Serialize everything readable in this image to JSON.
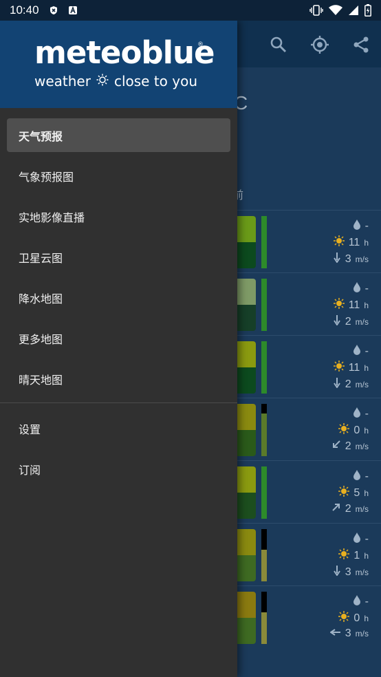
{
  "status_bar": {
    "time": "10:40",
    "left_icons": [
      "privacy-shield-icon",
      "text-a-icon"
    ],
    "right_icons": [
      "vibrate-icon",
      "wifi-icon",
      "signal-icon",
      "battery-icon"
    ]
  },
  "drawer": {
    "logo": "meteoblue",
    "logo_mark": "®",
    "tagline_left": "weather",
    "tagline_right": "close to you",
    "items": [
      {
        "label": "天气预报",
        "active": true
      },
      {
        "label": "气象预报图"
      },
      {
        "label": "实地影像直播"
      },
      {
        "label": "卫星云图"
      },
      {
        "label": "降水地图"
      },
      {
        "label": "更多地图"
      },
      {
        "label": "晴天地图"
      }
    ],
    "secondary_items": [
      {
        "label": "设置"
      },
      {
        "label": "订阅"
      }
    ]
  },
  "background": {
    "toolbar_icons": [
      "search-icon",
      "locate-icon",
      "share-icon"
    ],
    "partial_temp": "C",
    "partial_char": "前",
    "days": [
      {
        "rain": "-",
        "sun": "11",
        "sun_unit": "h",
        "wind": "3",
        "wind_unit": "m/s"
      },
      {
        "rain": "-",
        "sun": "11",
        "sun_unit": "h",
        "wind": "2",
        "wind_unit": "m/s"
      },
      {
        "rain": "-",
        "sun": "11",
        "sun_unit": "h",
        "wind": "2",
        "wind_unit": "m/s"
      },
      {
        "rain": "-",
        "sun": "0",
        "sun_unit": "h",
        "wind": "2",
        "wind_unit": "m/s"
      },
      {
        "rain": "-",
        "sun": "5",
        "sun_unit": "h",
        "wind": "2",
        "wind_unit": "m/s"
      },
      {
        "rain": "-",
        "sun": "1",
        "sun_unit": "h",
        "wind": "3",
        "wind_unit": "m/s"
      },
      {
        "rain": "-",
        "sun": "0",
        "sun_unit": "h",
        "wind": "3",
        "wind_unit": "m/s"
      }
    ]
  }
}
